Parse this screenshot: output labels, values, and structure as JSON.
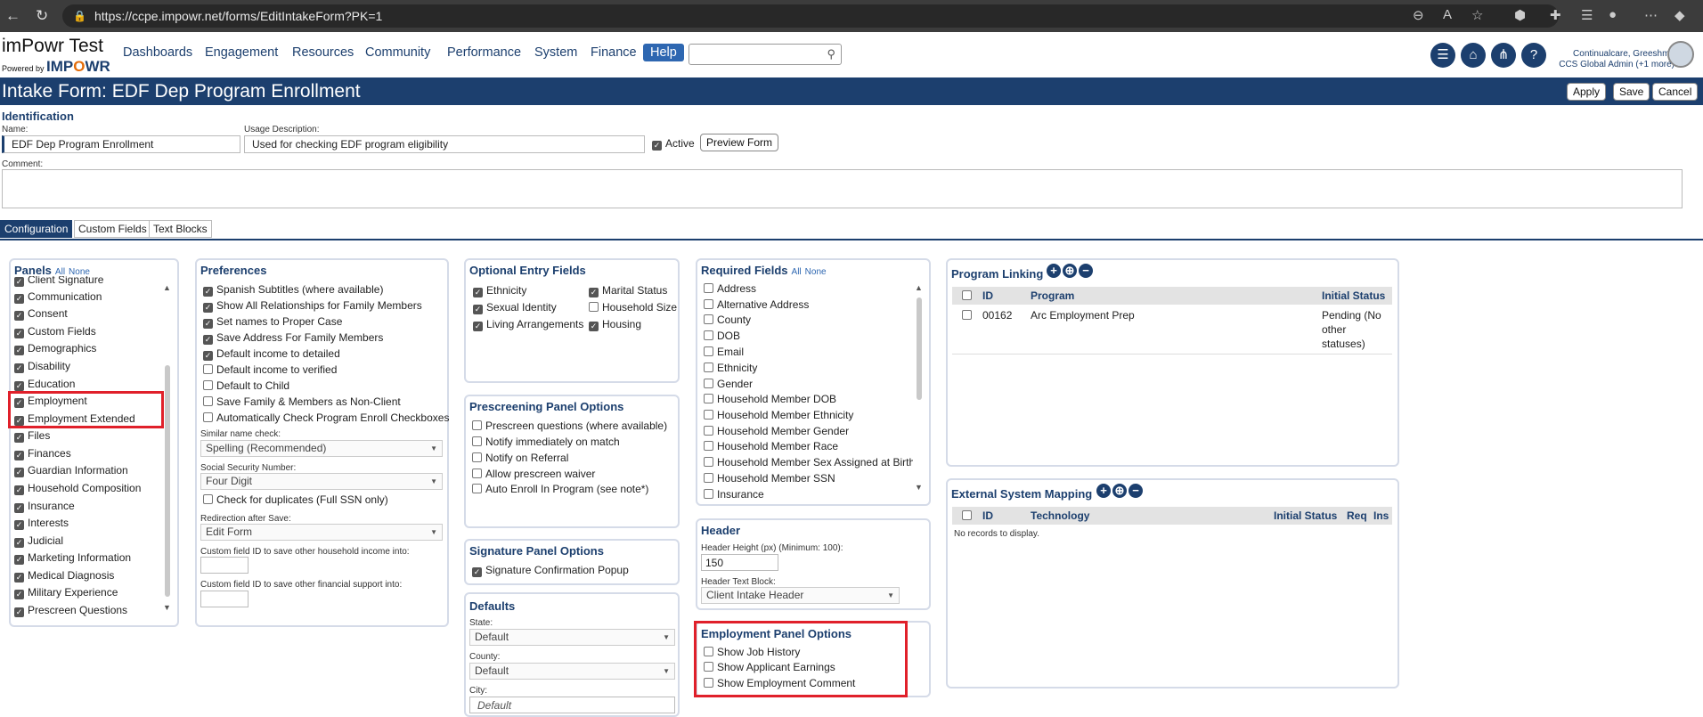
{
  "browser": {
    "url": "https://ccpe.impowr.net/forms/EditIntakeForm?PK=1"
  },
  "app": {
    "logo_title": "imPowr Test",
    "logo_powered": "Powered by",
    "logo_brand_a": "IMP",
    "logo_brand_b": "O",
    "logo_brand_c": "WR",
    "menu": [
      "Dashboards",
      "Engagement",
      "Resources",
      "Community",
      "Performance",
      "System",
      "Finance"
    ],
    "help_label": "Help",
    "user_name": "Continualcare, Greeshma",
    "user_role": "CCS Global Admin (+1 more)"
  },
  "page": {
    "title": "Intake Form: EDF Dep Program Enrollment",
    "apply_label": "Apply",
    "save_label": "Save",
    "cancel_label": "Cancel"
  },
  "identification": {
    "heading": "Identification",
    "name_label": "Name:",
    "name_value": "EDF Dep Program Enrollment",
    "usage_label": "Usage Description:",
    "usage_value": "Used for checking EDF program eligibility",
    "active_label": "Active",
    "preview_label": "Preview Form",
    "comment_label": "Comment:"
  },
  "tabs": [
    "Configuration",
    "Custom Fields",
    "Text Blocks"
  ],
  "panels": {
    "title": "Panels",
    "all": "All",
    "none": "None",
    "items": [
      "Client Signature",
      "Communication",
      "Consent",
      "Custom Fields",
      "Demographics",
      "Disability",
      "Education",
      "Employment",
      "Employment Extended",
      "Files",
      "Finances",
      "Guardian Information",
      "Household Composition",
      "Insurance",
      "Interests",
      "Judicial",
      "Marketing Information",
      "Medical Diagnosis",
      "Military Experience",
      "Prescreen Questions"
    ]
  },
  "preferences": {
    "title": "Preferences",
    "items": [
      {
        "label": "Spanish Subtitles (where available)",
        "checked": true
      },
      {
        "label": "Show All Relationships for Family Members",
        "checked": true
      },
      {
        "label": "Set names to Proper Case",
        "checked": true
      },
      {
        "label": "Save Address For Family Members",
        "checked": true
      },
      {
        "label": "Default income to detailed",
        "checked": true
      },
      {
        "label": "Default income to verified",
        "checked": false
      },
      {
        "label": "Default to Child",
        "checked": false
      },
      {
        "label": "Save Family & Members as Non-Client",
        "checked": false
      },
      {
        "label": "Automatically Check Program Enroll Checkboxes",
        "checked": false
      }
    ],
    "similar_label": "Similar name check:",
    "similar_value": "Spelling (Recommended)",
    "ssn_label": "Social Security Number:",
    "ssn_value": "Four Digit",
    "dup_label": "Check for duplicates (Full SSN only)",
    "redirect_label": "Redirection after Save:",
    "redirect_value": "Edit Form",
    "cf_income_label": "Custom field ID to save other household income into:",
    "cf_support_label": "Custom field ID to save other financial support into:"
  },
  "optional": {
    "title": "Optional Entry Fields",
    "items": [
      {
        "label": "Ethnicity",
        "checked": true
      },
      {
        "label": "Marital Status",
        "checked": true
      },
      {
        "label": "Sexual Identity",
        "checked": true
      },
      {
        "label": "Household Size",
        "checked": false
      },
      {
        "label": "Living Arrangements",
        "checked": true
      },
      {
        "label": "Housing",
        "checked": true
      }
    ]
  },
  "prescreen": {
    "title": "Prescreening Panel Options",
    "items": [
      "Prescreen questions (where available)",
      "Notify immediately on match",
      "Notify on Referral",
      "Allow prescreen waiver",
      "Auto Enroll In Program (see note*)"
    ]
  },
  "signature": {
    "title": "Signature Panel Options",
    "item": "Signature Confirmation Popup"
  },
  "defaults": {
    "title": "Defaults",
    "state_label": "State:",
    "state_value": "Default",
    "county_label": "County:",
    "county_value": "Default",
    "city_label": "City:",
    "city_placeholder": "Default"
  },
  "required": {
    "title": "Required Fields",
    "all": "All",
    "none": "None",
    "items": [
      "Address",
      "Alternative Address",
      "County",
      "DOB",
      "Email",
      "Ethnicity",
      "Gender",
      "Household Member DOB",
      "Household Member Ethnicity",
      "Household Member Gender",
      "Household Member Race",
      "Household Member Sex Assigned at Birth",
      "Household Member SSN",
      "Insurance"
    ]
  },
  "header": {
    "title": "Header",
    "height_label": "Header Height (px) (Minimum: 100):",
    "height_value": "150",
    "block_label": "Header Text Block:",
    "block_value": "Client Intake Header"
  },
  "employment": {
    "title": "Employment Panel Options",
    "items": [
      "Show Job History",
      "Show Applicant Earnings",
      "Show Employment Comment"
    ]
  },
  "program_linking": {
    "title": "Program Linking",
    "columns": [
      "ID",
      "Program",
      "Initial Status"
    ],
    "row": {
      "id": "00162",
      "program": "Arc Employment Prep",
      "status_lines": [
        "Pending (No",
        "other",
        "statuses)"
      ]
    }
  },
  "external": {
    "title": "External System Mapping",
    "columns": [
      "ID",
      "Technology",
      "Initial Status",
      "Req",
      "Ins"
    ],
    "empty": "No records to display."
  }
}
